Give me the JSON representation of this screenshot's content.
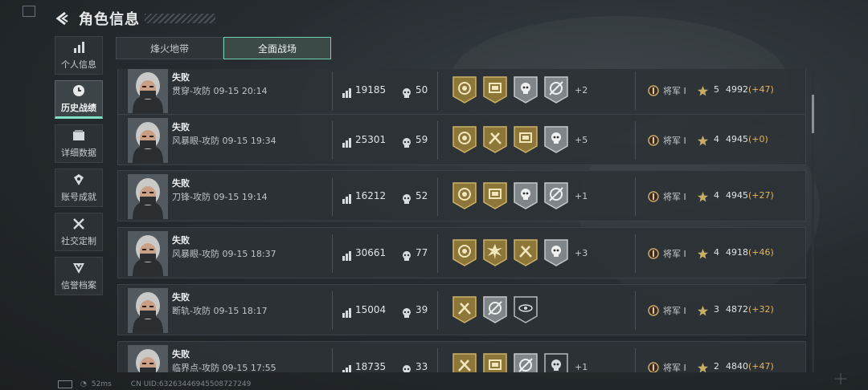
{
  "header": {
    "title": "角色信息"
  },
  "sidebar": {
    "items": [
      {
        "label": "个人信息"
      },
      {
        "label": "历史战绩"
      },
      {
        "label": "详细数据"
      },
      {
        "label": "账号成就"
      },
      {
        "label": "社交定制"
      },
      {
        "label": "信誉档案"
      }
    ]
  },
  "tabs": [
    {
      "label": "烽火地带"
    },
    {
      "label": "全面战场"
    }
  ],
  "matches": [
    {
      "result": "失败",
      "mode": "贯穿-攻防 09-15 20:14",
      "score": "19185",
      "kills": "50",
      "medals": [
        "gold-wreath",
        "gold-screen",
        "silver-skull",
        "silver-crosshair"
      ],
      "more": "+2",
      "rank": "将军 I",
      "stars": "5",
      "rating": "4992",
      "delta": "(+47)"
    },
    {
      "result": "失败",
      "mode": "风暴眼-攻防 09-15 19:34",
      "score": "25301",
      "kills": "59",
      "medals": [
        "gold-wreath",
        "gold-hammers",
        "gold-screen",
        "silver-skull"
      ],
      "more": "+5",
      "rank": "将军 I",
      "stars": "4",
      "rating": "4945",
      "delta": "(+0)"
    },
    {
      "result": "失败",
      "mode": "刀锋-攻防 09-15 19:14",
      "score": "16212",
      "kills": "52",
      "medals": [
        "gold-wreath",
        "gold-screen",
        "silver-skull",
        "silver-crosshair"
      ],
      "more": "+1",
      "rank": "将军 I",
      "stars": "4",
      "rating": "4945",
      "delta": "(+27)"
    },
    {
      "result": "失败",
      "mode": "风暴眼-攻防 09-15 18:37",
      "score": "30661",
      "kills": "77",
      "medals": [
        "gold-wreath",
        "gold-burst",
        "gold-hammers",
        "silver-skull"
      ],
      "more": "+3",
      "rank": "将军 I",
      "stars": "4",
      "rating": "4918",
      "delta": "(+46)"
    },
    {
      "result": "失败",
      "mode": "断轨-攻防 09-15 18:17",
      "score": "15004",
      "kills": "39",
      "medals": [
        "gold-hammers",
        "silver-crosshair",
        "dark-eye"
      ],
      "more": "",
      "rank": "将军 I",
      "stars": "3",
      "rating": "4872",
      "delta": "(+32)"
    },
    {
      "result": "失败",
      "mode": "临界点-攻防 09-15 17:55",
      "score": "18735",
      "kills": "33",
      "medals": [
        "gold-hammers",
        "gold-screen",
        "silver-crosshair",
        "dark-star-skull"
      ],
      "more": "+1",
      "rank": "将军 I",
      "stars": "2",
      "rating": "4840",
      "delta": "(+47)"
    }
  ],
  "status": {
    "ping": "52ms",
    "uid": "CN UID:6326344694550872724​9"
  },
  "colors": {
    "accent": "#7fe0c4",
    "gold": "#b89a4e",
    "delta": "#e6b65a"
  }
}
